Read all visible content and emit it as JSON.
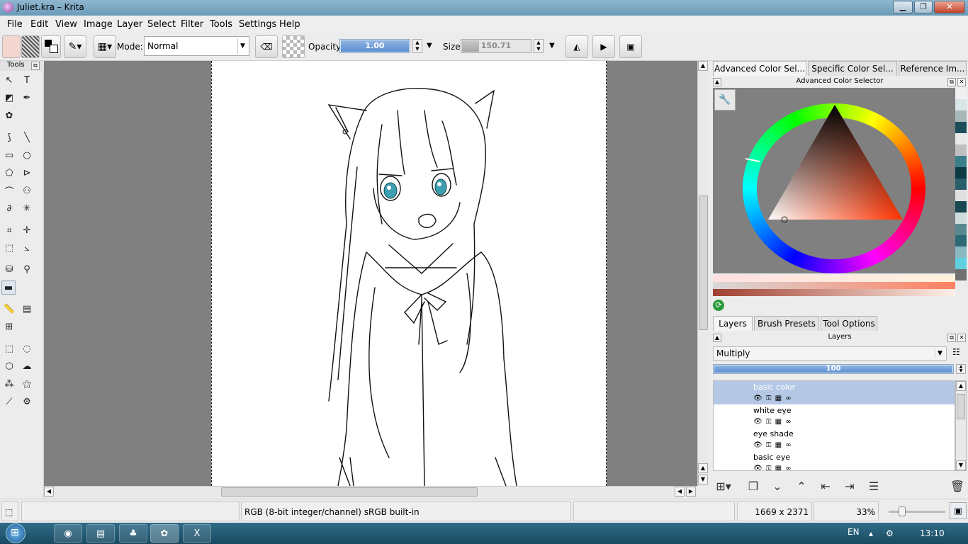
{
  "window": {
    "title": "Juliet.kra – Krita",
    "minimize": "▁",
    "maximize": "❐",
    "close": "✕"
  },
  "menu": [
    "File",
    "Edit",
    "View",
    "Image",
    "Layer",
    "Select",
    "Filter",
    "Tools",
    "Settings",
    "Help"
  ],
  "toolbar": {
    "mode_label": "Mode:",
    "mode_value": "Normal",
    "opacity_label": "Opacity:",
    "opacity_value": "1.00",
    "size_label": "Size:",
    "size_value": "150.71"
  },
  "tools_docker": {
    "title": "Tools"
  },
  "tabs_top": [
    "Advanced Color Sel...",
    "Specific Color Sel...",
    "Reference Im..."
  ],
  "color_selector": {
    "title": "Advanced Color Selector"
  },
  "tabs_bottom": [
    "Layers",
    "Brush Presets",
    "Tool Options"
  ],
  "layers": {
    "title": "Layers",
    "blend_mode": "Multiply",
    "opacity": "100",
    "items": [
      {
        "name": "basic color",
        "selected": true
      },
      {
        "name": "white eye",
        "selected": false
      },
      {
        "name": "eye shade",
        "selected": false
      },
      {
        "name": "basic eye",
        "selected": false
      }
    ]
  },
  "status": {
    "color_profile": "RGB (8-bit integer/channel)  sRGB built-in",
    "dimensions": "1669 x 2371",
    "zoom": "33%"
  },
  "taskbar": {
    "language": "EN",
    "time": "13:10"
  },
  "colors": {
    "selected_layer": "#b4c8e6",
    "canvas_bg": "#808080",
    "accent": "#5b8fd0"
  }
}
